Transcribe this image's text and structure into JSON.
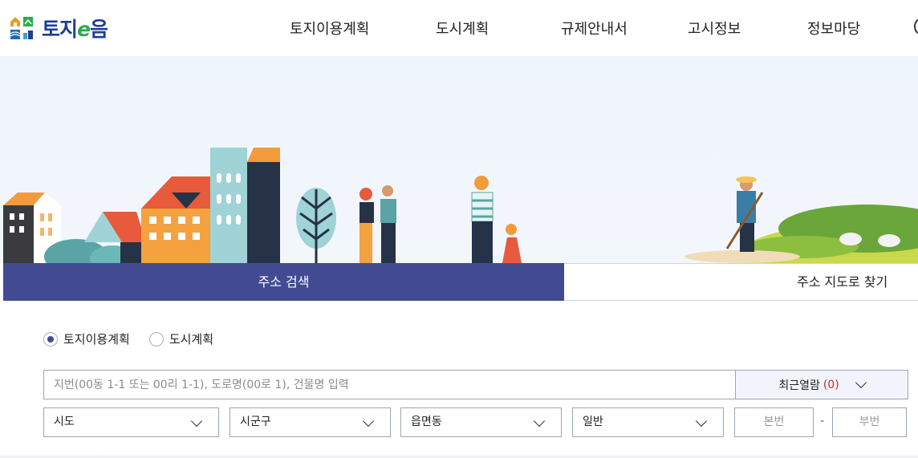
{
  "header": {
    "logo_text_a": "토지",
    "logo_text_e": "e",
    "logo_text_b": "음",
    "nav": [
      "토지이용계획",
      "도시계획",
      "규제안내서",
      "고시정보",
      "정보마당"
    ]
  },
  "tabs": {
    "active": "주소 검색",
    "other": "주소 지도로 찾기"
  },
  "search": {
    "radios": [
      {
        "label": "토지이용계획",
        "checked": true
      },
      {
        "label": "도시계획",
        "checked": false
      }
    ],
    "placeholder": "지번(00동 1-1 또는 00리 1-1), 도로명(00로 1), 건물명 입력",
    "recent_label": "최근열람",
    "recent_count": "(0)",
    "selects": [
      "시도",
      "시군구",
      "읍면동",
      "일반"
    ],
    "bonbeon": "본번",
    "dash": "-",
    "bubeon": "부번"
  },
  "colors": {
    "brand": "#1d3f93",
    "tab_active": "#424b92",
    "accent_red": "#e0202a"
  },
  "icons": {
    "logo": "house-grid-logo-icon",
    "dropdown": "chevron-down-icon"
  }
}
